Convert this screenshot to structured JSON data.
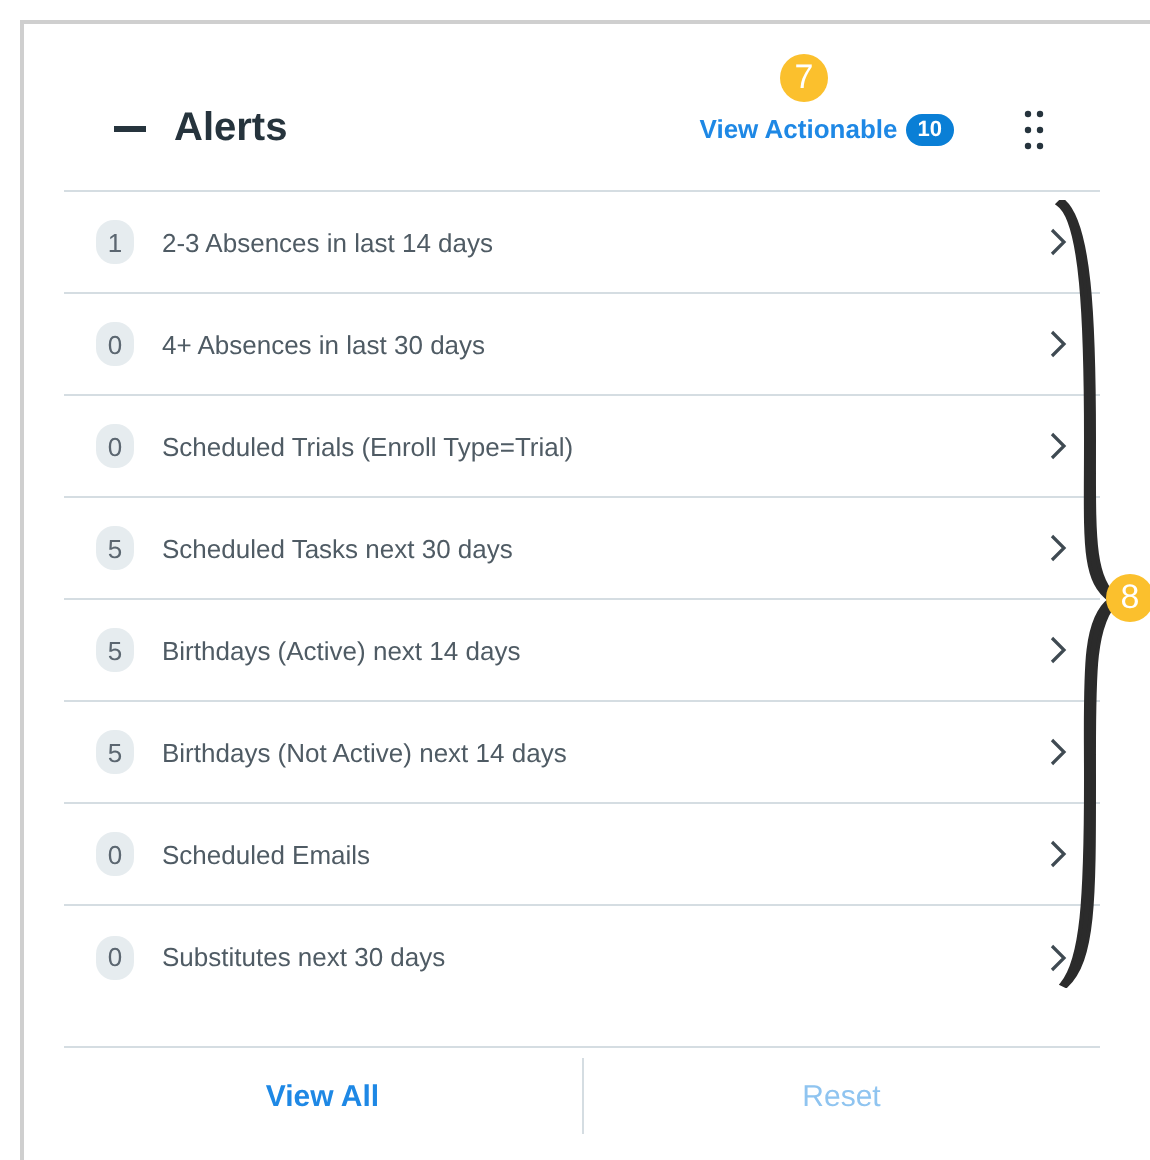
{
  "panel": {
    "title": "Alerts",
    "actionable_link": "View Actionable",
    "actionable_count": "10"
  },
  "alerts": [
    {
      "count": "1",
      "label": "2-3 Absences in last 14 days"
    },
    {
      "count": "0",
      "label": "4+ Absences in last 30 days"
    },
    {
      "count": "0",
      "label": "Scheduled Trials (Enroll Type=Trial)"
    },
    {
      "count": "5",
      "label": "Scheduled Tasks next 30 days"
    },
    {
      "count": "5",
      "label": "Birthdays (Active) next 14 days"
    },
    {
      "count": "5",
      "label": "Birthdays (Not Active) next 14 days"
    },
    {
      "count": "0",
      "label": "Scheduled Emails"
    },
    {
      "count": "0",
      "label": "Substitutes next 30 days"
    }
  ],
  "footer_buttons": [
    {
      "label": "View All",
      "disabled": false
    },
    {
      "label": "Reset",
      "disabled": true
    }
  ],
  "callouts": [
    "7",
    "8"
  ]
}
